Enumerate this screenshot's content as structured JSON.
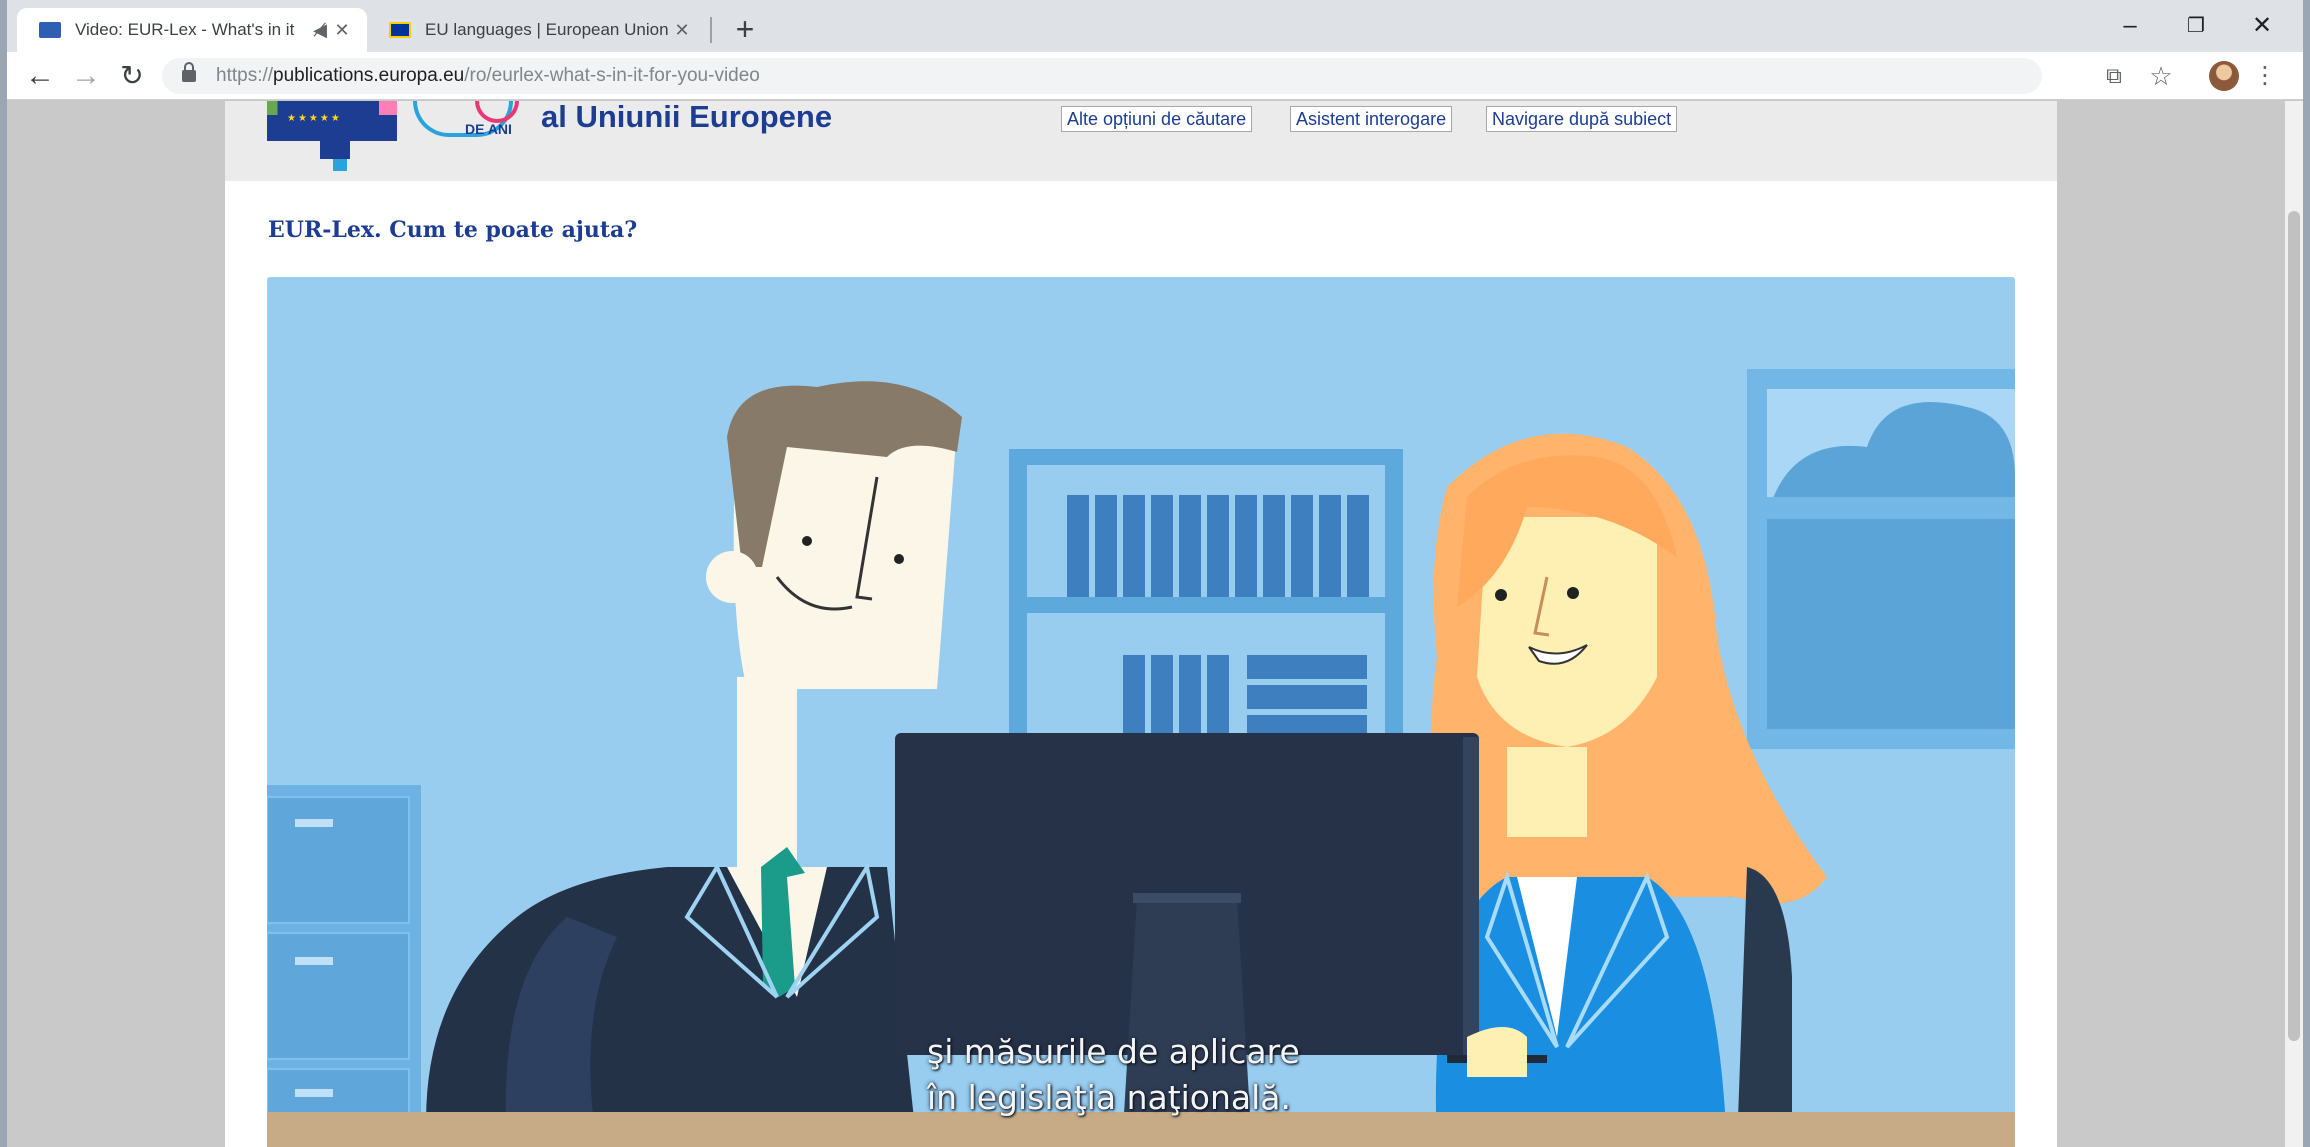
{
  "browser": {
    "tabs": [
      {
        "title": "Video: EUR-Lex - What's in it",
        "favicon_color": "#2f5fb3",
        "active": true
      },
      {
        "title": "EU languages | European Union",
        "favicon_color": "#003399",
        "active": false
      }
    ],
    "url": {
      "host_prefix": "https://",
      "host": "publications.europa.eu",
      "path": "/ro/eurlex-what-s-in-it-for-you-video"
    },
    "icons": [
      "back-icon",
      "forward-icon",
      "reload-icon",
      "lock-icon",
      "translate-icon",
      "star-icon",
      "menu-icon"
    ]
  },
  "header": {
    "logo_caption": "DE ANI",
    "site_title": "al Uniunii Europene",
    "links": [
      "Alte opțiuni de căutare",
      "Asistent interogare",
      "Navigare după subiect"
    ]
  },
  "main": {
    "heading": "EUR-Lex. Cum te poate ajuta?",
    "video": {
      "subtitle_line1": "şi măsurile de aplicare",
      "subtitle_line2": "în legislaţia naţională."
    }
  },
  "colors": {
    "eu_blue": "#1c3d91",
    "video_background": "#98cdef",
    "tab_strip": "#dee1e6"
  }
}
